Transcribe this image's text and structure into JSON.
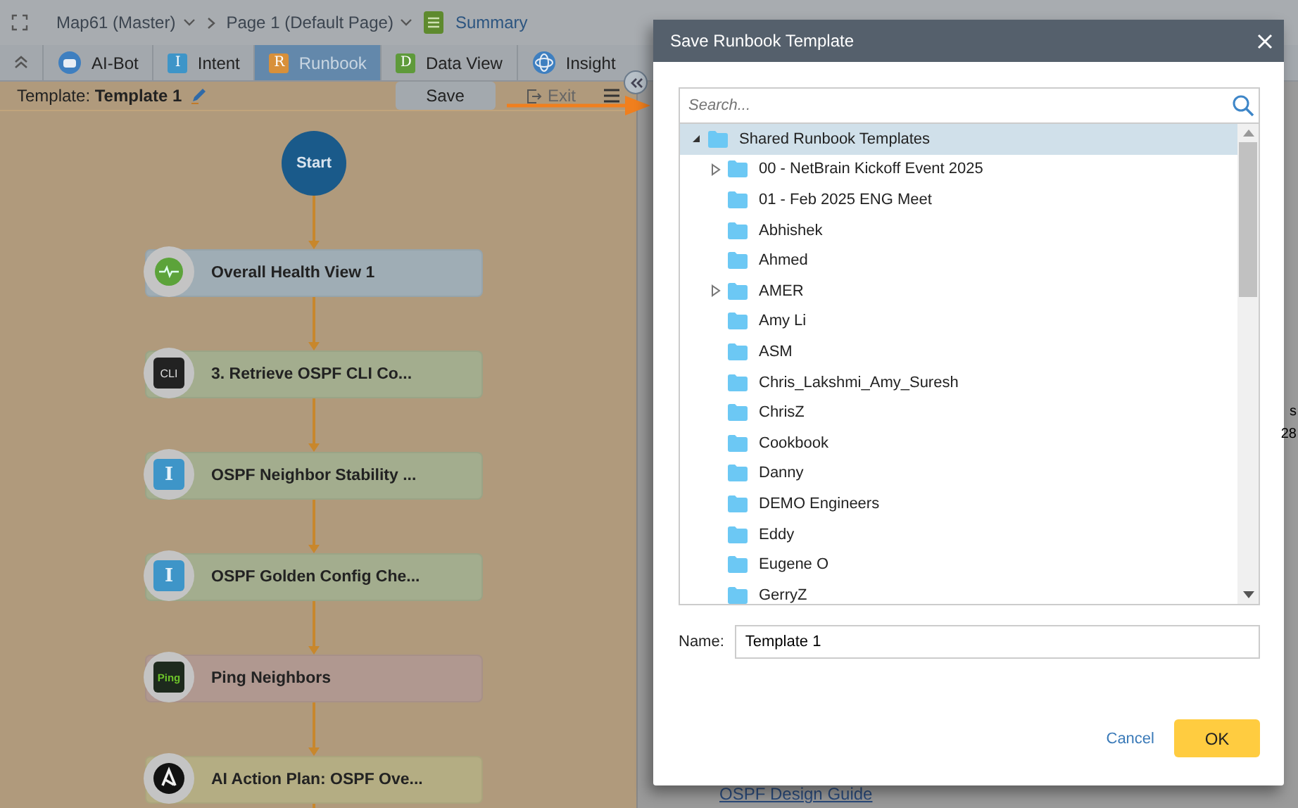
{
  "top_bar": {
    "breadcrumbs": [
      {
        "label": "Map61 (Master)"
      },
      {
        "label": "Page 1  (Default Page)"
      }
    ],
    "summary": "Summary"
  },
  "tabs": [
    {
      "label": "AI-Bot",
      "kind": "bot",
      "selected": false
    },
    {
      "label": "Intent",
      "kind": "intent",
      "icon_letter": "I",
      "selected": false
    },
    {
      "label": "Runbook",
      "kind": "runbook",
      "icon_letter": "R",
      "selected": true
    },
    {
      "label": "Data View",
      "kind": "dataview",
      "icon_letter": "D",
      "selected": false
    },
    {
      "label": "Insight",
      "kind": "insight",
      "selected": false
    }
  ],
  "runbook_toolbar": {
    "template": "Template: **Template 1**",
    "save": "Save",
    "exit": "Exit"
  },
  "flow": {
    "start": "Start",
    "nodes": [
      {
        "label": "Overall Health View 1",
        "kind": "health",
        "color": "#9fadb5"
      },
      {
        "label": "3. Retrieve OSPF CLI Co...",
        "kind": "cli",
        "badge": "CLI",
        "color": "#a3ad8e"
      },
      {
        "label": "OSPF Neighbor Stability ...",
        "kind": "intent",
        "badge": "I",
        "color": "#a3ad8e"
      },
      {
        "label": "OSPF Golden Config Che...",
        "kind": "intent",
        "badge": "I",
        "color": "#a3ad8e"
      },
      {
        "label": "Ping Neighbors",
        "kind": "ping",
        "badge": "Ping",
        "color": "#b09890"
      },
      {
        "label": "AI Action Plan: OSPF Ove...",
        "kind": "ansible",
        "color": "#b4ad83"
      }
    ]
  },
  "background_panel": {
    "fragments": [
      "s",
      "28"
    ],
    "links": [
      "OSPF Design Guide"
    ]
  },
  "dialog": {
    "title": "Save Runbook Template",
    "search": {
      "placeholder": "Search..."
    },
    "tree": [
      {
        "label": "Shared Runbook Templates",
        "expanded": true,
        "selected": true,
        "children": [
          {
            "label": "00 - NetBrain Kickoff Event 2025",
            "expanded": false,
            "selected": false
          },
          {
            "label": "01 - Feb 2025 ENG Meet",
            "selected": false
          },
          {
            "label": "Abhishek",
            "selected": false
          },
          {
            "label": "Ahmed",
            "selected": false
          },
          {
            "label": "AMER",
            "expanded": false,
            "selected": false
          },
          {
            "label": "Amy Li",
            "selected": false
          },
          {
            "label": "ASM",
            "selected": false
          },
          {
            "label": "Chris_Lakshmi_Amy_Suresh",
            "selected": false
          },
          {
            "label": "ChrisZ",
            "selected": false
          },
          {
            "label": "Cookbook",
            "selected": false
          },
          {
            "label": "Danny",
            "selected": false
          },
          {
            "label": "DEMO Engineers",
            "selected": false
          },
          {
            "label": "Eddy",
            "selected": false
          },
          {
            "label": "Eugene O",
            "selected": false
          },
          {
            "label": "GerryZ",
            "selected": false
          }
        ]
      }
    ],
    "name_label": "Name:",
    "name_value": "Template 1",
    "cancel": "Cancel",
    "ok": "OK"
  }
}
